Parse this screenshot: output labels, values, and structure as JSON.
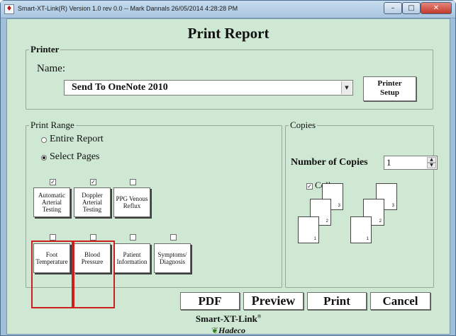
{
  "window": {
    "title": "Smart-XT-Link(R)  Version 1.0 rev 0.0  -- Mark Dannals  26/05/2014   4:28:28 PM",
    "app_icon": "app-icon",
    "controls": {
      "minimize": "–",
      "maximize": "□",
      "close": "✕"
    }
  },
  "page_title": "Print Report",
  "printer": {
    "legend": "Printer",
    "name_label": "Name:",
    "selected": "Send To OneNote 2010",
    "setup_line1": "Printer",
    "setup_line2": "Setup"
  },
  "print_range": {
    "legend": "Print Range",
    "options": [
      {
        "label": "Entire Report",
        "selected": false
      },
      {
        "label": "Select Pages",
        "selected": true
      }
    ],
    "pages": [
      {
        "label": "Automatic Arterial Testing",
        "checked": true
      },
      {
        "label": "Doppler Arterial Testing",
        "checked": true
      },
      {
        "label": "PPG Venous Reflux",
        "checked": false
      },
      {
        "label": "Foot Temperature",
        "checked": false
      },
      {
        "label": "Blood Pressure",
        "checked": false
      },
      {
        "label": "Patient Information",
        "checked": false
      },
      {
        "label": "Symptoms/ Diagnosis",
        "checked": false
      }
    ]
  },
  "copies": {
    "legend": "Copies",
    "label": "Number of Copies",
    "value": "1",
    "collate_label": "Collate",
    "collate_checked": true,
    "sheet_numbers": [
      "3",
      "2",
      "1",
      "3",
      "2",
      "1"
    ]
  },
  "buttons": {
    "pdf": "PDF",
    "preview": "Preview",
    "print": "Print",
    "cancel": "Cancel"
  },
  "brand": {
    "name": "Smart-XT-Link",
    "reg": "®",
    "company": "Hadeco"
  },
  "colors": {
    "client_bg": "#cfe8d3",
    "highlight": "#cc2020",
    "titlebar": "#a9c6e0"
  }
}
